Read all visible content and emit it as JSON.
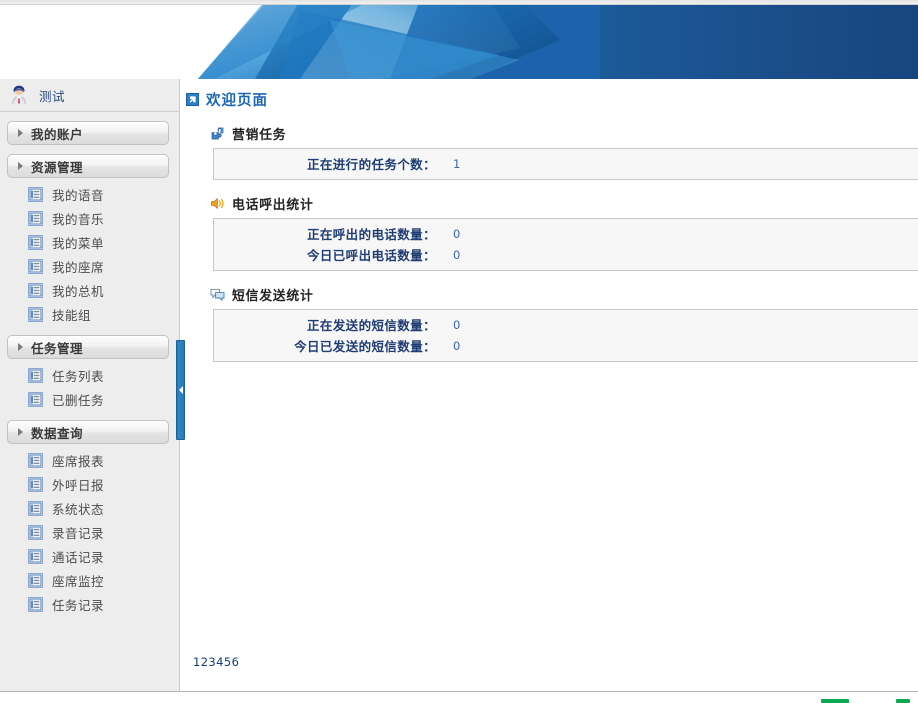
{
  "banner": {
    "name": "header-banner",
    "colors": {
      "deep_blue": "#1a5fa8",
      "mid_blue": "#1f77c4",
      "light_blue": "#79c0ec",
      "pale_blue": "#bcdff5",
      "dark_navy": "#18457e"
    }
  },
  "sidebar": {
    "user": {
      "name": "测试",
      "avatar_icon": "user-avatar-icon"
    },
    "groups": [
      {
        "label": "我的账户",
        "arrow_icon": "triangle-right-icon",
        "items": []
      },
      {
        "label": "资源管理",
        "arrow_icon": "triangle-right-icon",
        "items": [
          {
            "label": "我的语音",
            "icon": "document-list-icon"
          },
          {
            "label": "我的音乐",
            "icon": "document-list-icon"
          },
          {
            "label": "我的菜单",
            "icon": "document-list-icon"
          },
          {
            "label": "我的座席",
            "icon": "document-list-icon"
          },
          {
            "label": "我的总机",
            "icon": "document-list-icon"
          },
          {
            "label": "技能组",
            "icon": "document-list-icon"
          }
        ]
      },
      {
        "label": "任务管理",
        "arrow_icon": "triangle-right-icon",
        "items": [
          {
            "label": "任务列表",
            "icon": "document-list-icon"
          },
          {
            "label": "已删任务",
            "icon": "document-list-icon"
          }
        ]
      },
      {
        "label": "数据查询",
        "arrow_icon": "triangle-right-icon",
        "items": [
          {
            "label": "座席报表",
            "icon": "document-list-icon"
          },
          {
            "label": "外呼日报",
            "icon": "document-list-icon"
          },
          {
            "label": "系统状态",
            "icon": "document-list-icon"
          },
          {
            "label": "录音记录",
            "icon": "document-list-icon"
          },
          {
            "label": "通话记录",
            "icon": "document-list-icon"
          },
          {
            "label": "座席监控",
            "icon": "document-list-icon"
          },
          {
            "label": "任务记录",
            "icon": "document-list-icon"
          }
        ]
      }
    ],
    "splitter": {
      "name": "sidebar-collapse-splitter",
      "arrow_icon": "triangle-left-icon"
    }
  },
  "content": {
    "page_title": {
      "text": "欢迎页面",
      "icon": "arrow-down-right-square-icon",
      "color": "#1d66b3"
    },
    "sections": [
      {
        "title": "营销任务",
        "icon": "puzzle-piece-icon",
        "rows": [
          {
            "label": "正在进行的任务个数：",
            "value": "1"
          }
        ]
      },
      {
        "title": "电话呼出统计",
        "icon": "speaker-sound-icon",
        "rows": [
          {
            "label": "正在呼出的电话数量：",
            "value": "0"
          },
          {
            "label": "今日已呼出电话数量：",
            "value": "0"
          }
        ]
      },
      {
        "title": "短信发送统计",
        "icon": "speech-bubble-icon",
        "rows": [
          {
            "label": "正在发送的短信数量：",
            "value": "0"
          },
          {
            "label": "今日已发送的短信数量：",
            "value": "0"
          }
        ]
      }
    ],
    "footer_code": "123456"
  },
  "bottom_strip": {
    "name": "taskbar-strip",
    "indicator_color": "#0aa84f"
  }
}
